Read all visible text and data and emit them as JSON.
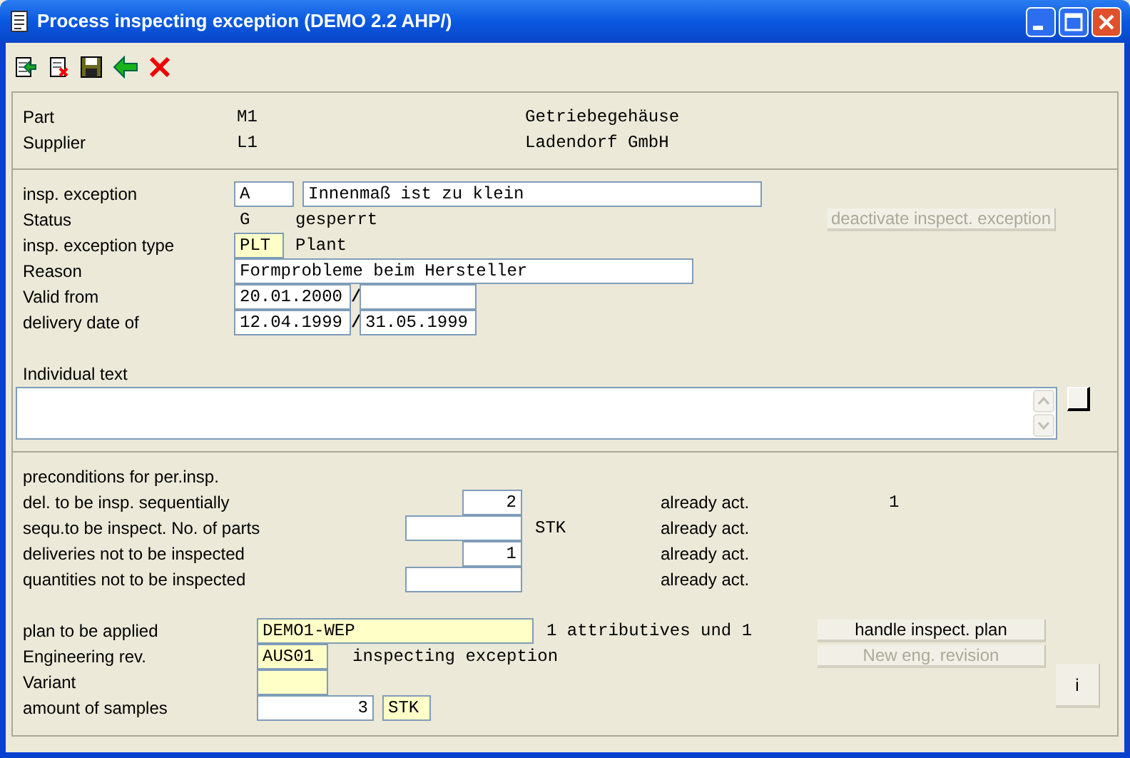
{
  "window": {
    "title": "Process inspecting exception (DEMO 2.2 AHP/)"
  },
  "header": [
    {
      "label": "Part",
      "code": "M1",
      "name": "Getriebegehäuse"
    },
    {
      "label": "Supplier",
      "code": "L1",
      "name": "Ladendorf GmbH"
    }
  ],
  "exception": {
    "code": {
      "label": "insp. exception",
      "value": "A",
      "description": "Innenmaß ist zu klein"
    },
    "status": {
      "label": "Status",
      "code": "G",
      "text": "gesperrt"
    },
    "deactivate_button": {
      "label": "deactivate inspect. exception",
      "disabled": true
    },
    "type": {
      "label": "insp. exception type",
      "value": "PLT",
      "text": "Plant"
    },
    "reason": {
      "label": "Reason",
      "value": "Formprobleme beim Hersteller"
    },
    "valid_from": {
      "label": "Valid from",
      "from": "20.01.2000",
      "separator": "/"
    },
    "delivery_date": {
      "label": "delivery date of",
      "from": "12.04.1999",
      "separator": "/",
      "to": "31.05.1999"
    },
    "individual_text": {
      "label": "Individual text"
    }
  },
  "preconditions": {
    "title": "preconditions for per.insp.",
    "rows": [
      {
        "label": "del. to be insp. sequentially",
        "kind": "short",
        "value": "2",
        "already_label": "already act.",
        "already_value": "1"
      },
      {
        "label": "sequ.to be inspect. No. of parts",
        "kind": "wide",
        "unit": "STK",
        "already_label": "already act."
      },
      {
        "label": "deliveries not to be inspected",
        "kind": "short",
        "value": "1",
        "already_label": "already act."
      },
      {
        "label": "quantities not to be inspected",
        "kind": "wide",
        "already_label": "already act."
      }
    ]
  },
  "plan": {
    "plan": {
      "label": "plan to be applied",
      "value": "DEMO1-WEP",
      "info": "1 attributives und 1"
    },
    "handle_button": {
      "label": "handle inspect. plan",
      "disabled": false
    },
    "revision": {
      "label": "Engineering rev.",
      "value": "AUS01",
      "text": "inspecting exception"
    },
    "new_revision_button": {
      "label": "New eng. revision",
      "disabled": true
    },
    "variant": {
      "label": "Variant"
    },
    "samples": {
      "label": "amount of samples",
      "value": "3",
      "unit": "STK"
    },
    "info_button": {
      "label": "i"
    }
  }
}
